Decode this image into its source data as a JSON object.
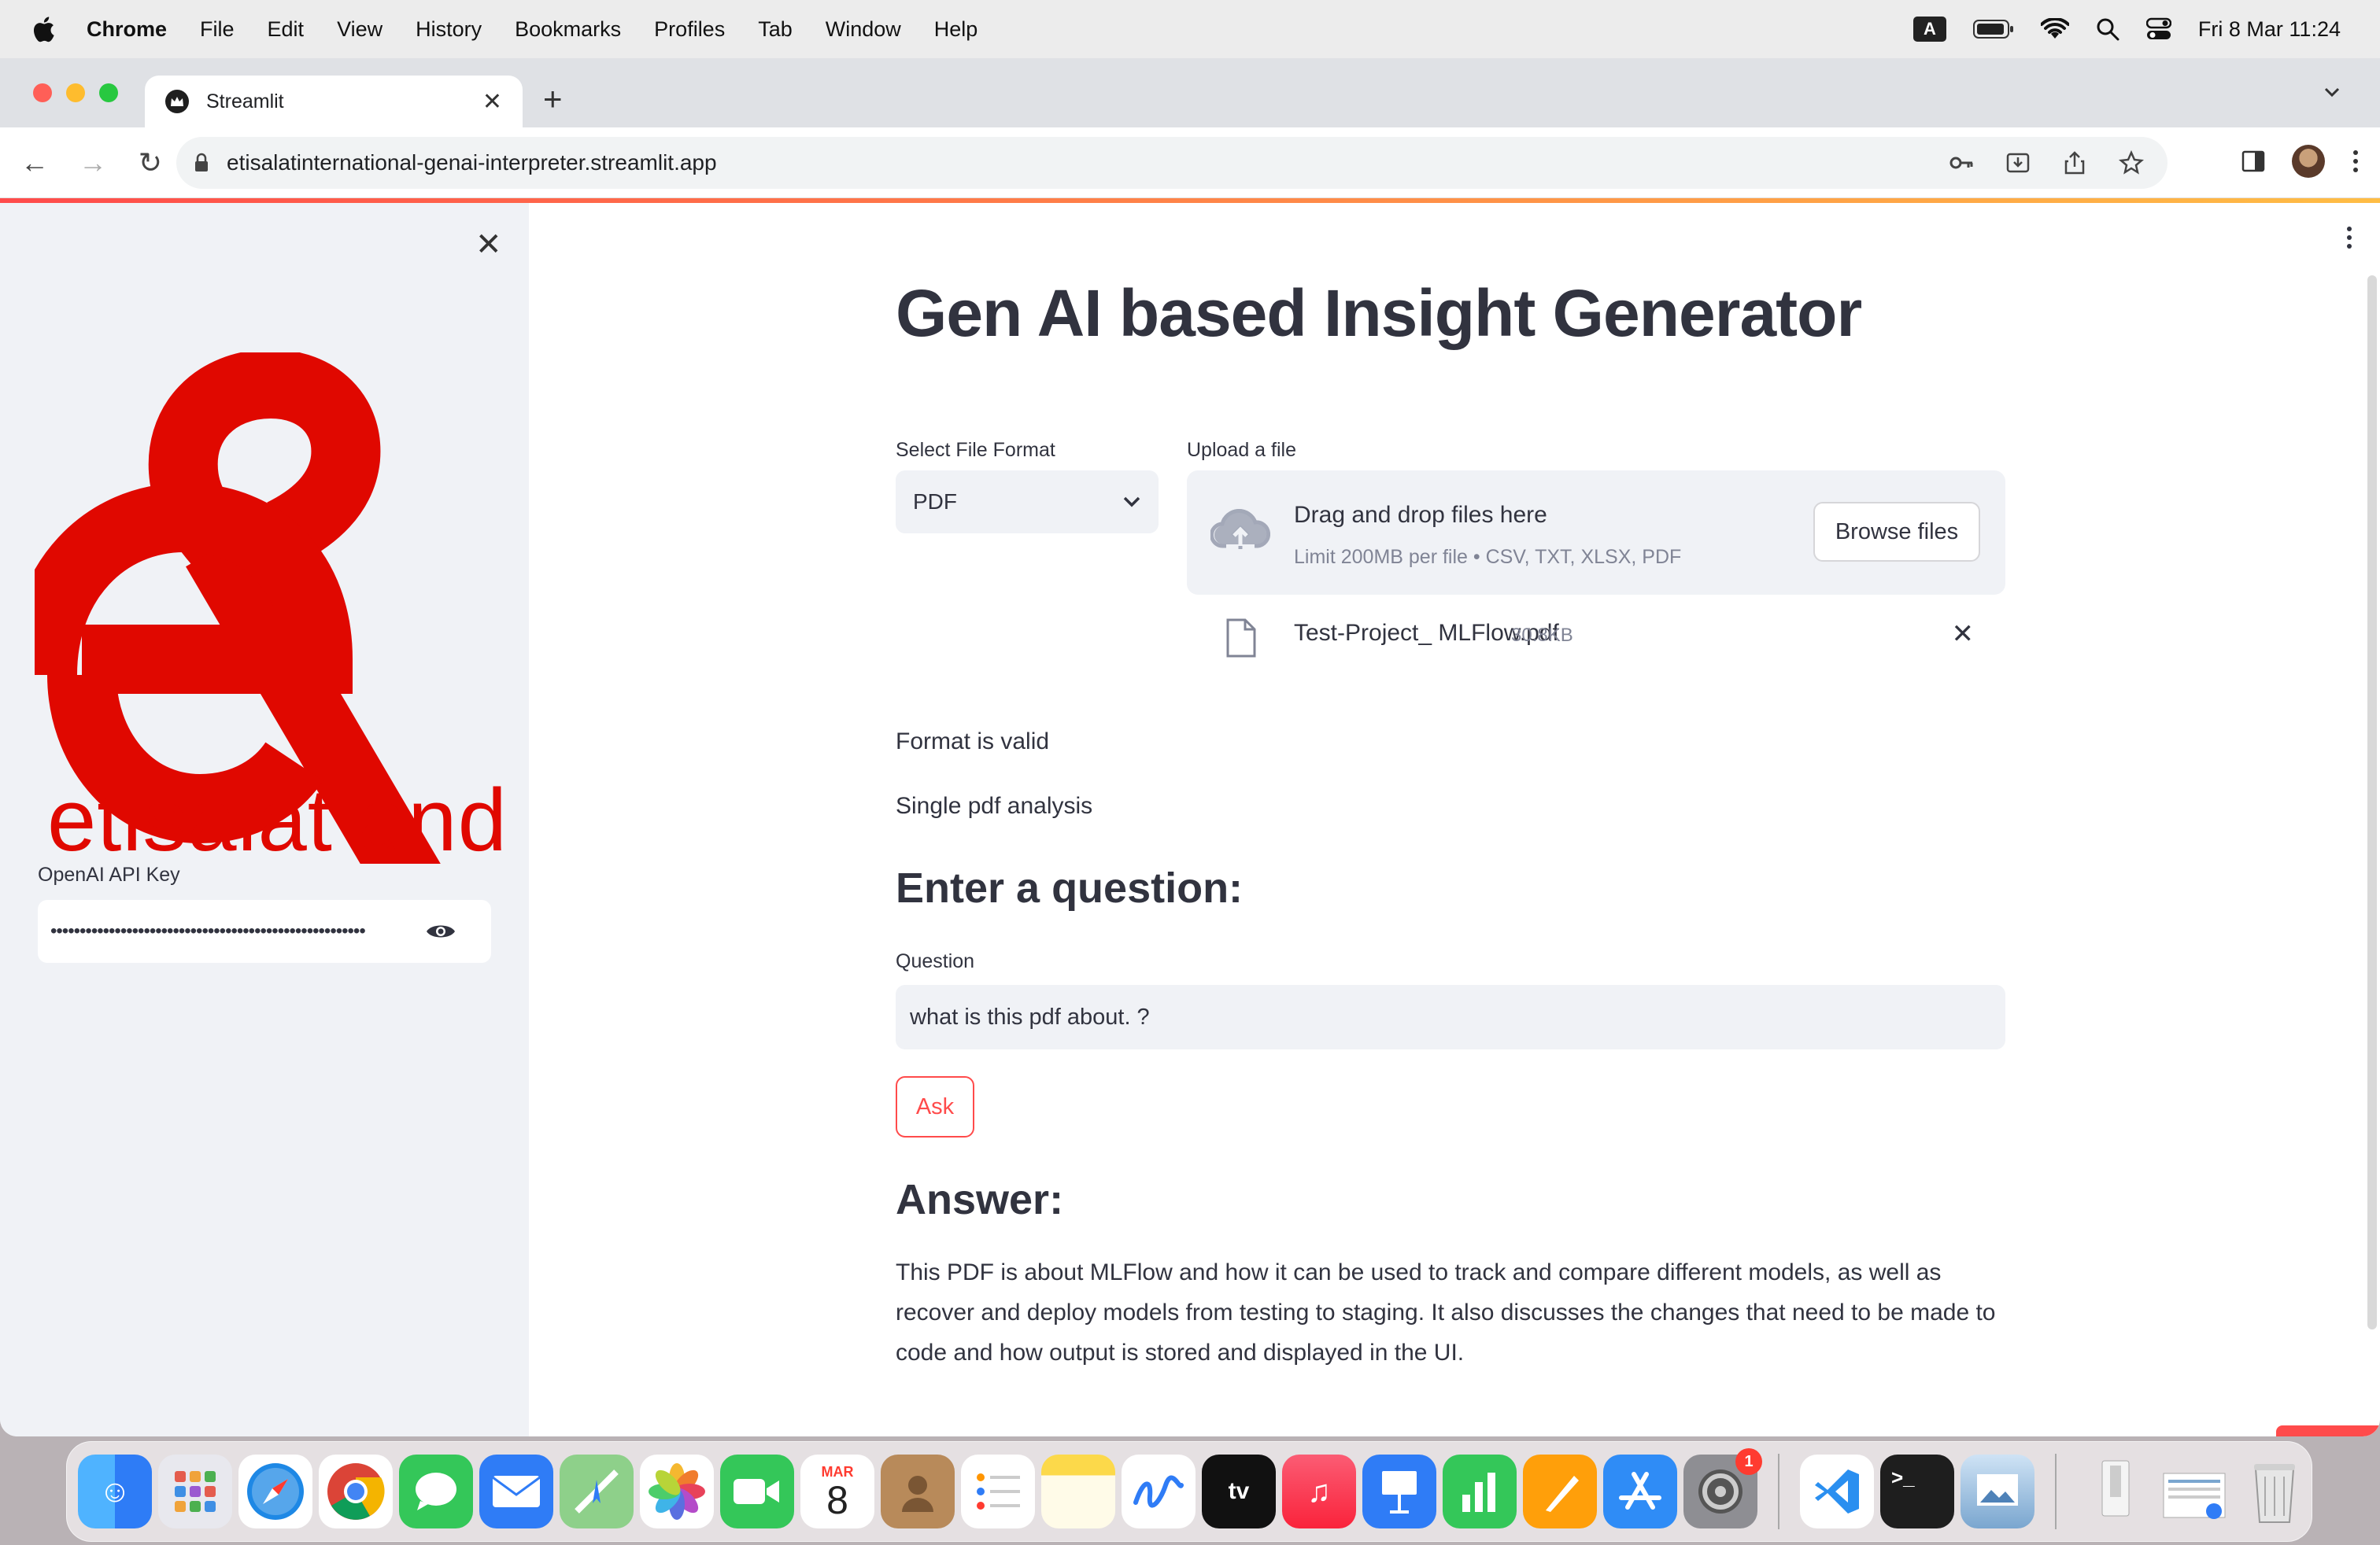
{
  "menubar": {
    "app": "Chrome",
    "items": [
      "File",
      "Edit",
      "View",
      "History",
      "Bookmarks",
      "Profiles",
      "Tab",
      "Window",
      "Help"
    ],
    "input_indicator": "A",
    "datetime": "Fri 8 Mar  11:24"
  },
  "browser": {
    "tab_title": "Streamlit",
    "url": "etisalatinternational-genai-interpreter.streamlit.app"
  },
  "sidebar": {
    "logo_text": "etisalat and",
    "api_key_label": "OpenAI API Key",
    "api_key_value": "••••••••••••••••••••••••••••••••••••••••••••••••••••••"
  },
  "main": {
    "title": "Gen AI based Insight Generator",
    "file_format_label": "Select File Format",
    "file_format_value": "PDF",
    "upload_label": "Upload a file",
    "dropzone_title": "Drag and drop files here",
    "dropzone_limit": "Limit 200MB per file • CSV, TXT, XLSX, PDF",
    "browse_label": "Browse files",
    "file_name": "Test-Project_ MLFlow.pdf",
    "file_size": "30.8KB",
    "status_valid": "Format is valid",
    "status_mode": "Single pdf analysis",
    "question_heading": "Enter a question:",
    "question_label": "Question",
    "question_value": "what is this pdf about. ?",
    "ask_label": "Ask",
    "answer_heading": "Answer:",
    "answer_text": "This PDF is about MLFlow and how it can be used to track and compare different models, as well as recover and deploy models from testing to staging. It also discusses the changes that need to be made to code and how output is stored and displayed in the UI."
  },
  "dock": {
    "calendar_month": "MAR",
    "calendar_day": "8",
    "settings_badge": "1",
    "apps": [
      "finder-icon",
      "launchpad-icon",
      "safari-icon",
      "chrome-icon",
      "messages-icon",
      "mail-icon",
      "maps-icon",
      "photos-icon",
      "facetime-icon",
      "calendar-icon",
      "contacts-icon",
      "reminders-icon",
      "notes-icon",
      "freeform-icon",
      "apple-tv-icon",
      "music-icon",
      "keynote-icon",
      "numbers-icon",
      "pages-icon",
      "app-store-icon",
      "system-settings-icon",
      "vscode-icon",
      "terminal-icon",
      "preview-icon",
      "downloads-icon",
      "documents-icon",
      "trash-icon"
    ]
  },
  "colors": {
    "brand_red": "#e00800",
    "accent": "#ff4b4b",
    "sidebar_bg": "#f0f2f6",
    "text": "#31333f"
  }
}
